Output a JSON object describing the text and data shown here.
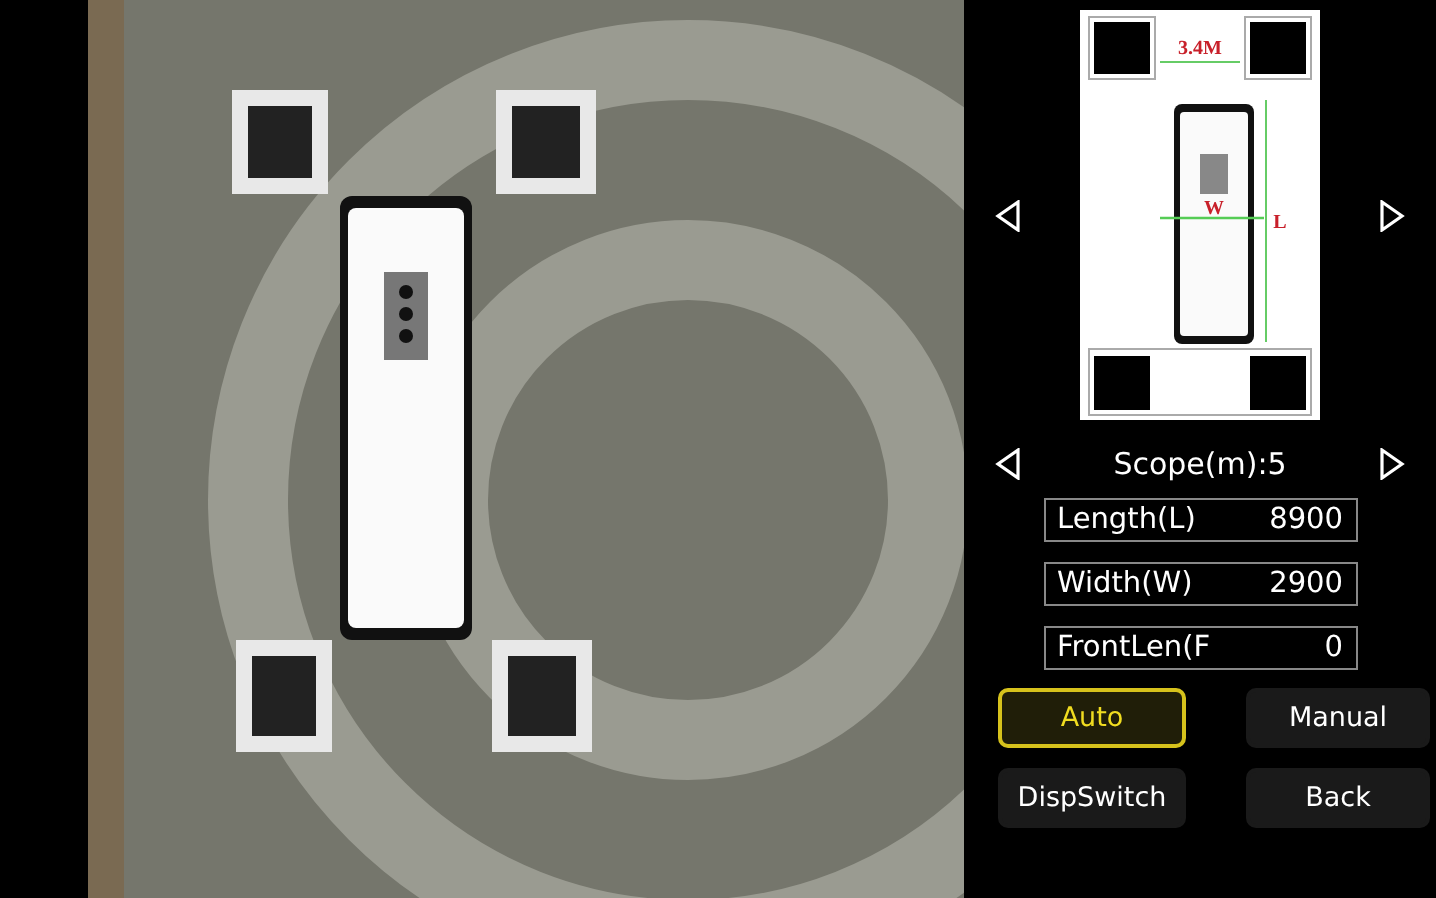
{
  "diagram": {
    "gap_label": "3.4M",
    "width_label": "W",
    "length_label": "L"
  },
  "scope": {
    "label": "Scope(m):5"
  },
  "fields": [
    {
      "label": "Length(L)",
      "value": "8900"
    },
    {
      "label": "Width(W)",
      "value": "2900"
    },
    {
      "label": "FrontLen(F",
      "value": "0"
    }
  ],
  "buttons": [
    {
      "label": "Auto",
      "selected": true
    },
    {
      "label": "Manual",
      "selected": false
    },
    {
      "label": "DispSwitch",
      "selected": false
    },
    {
      "label": "Back",
      "selected": false
    }
  ]
}
